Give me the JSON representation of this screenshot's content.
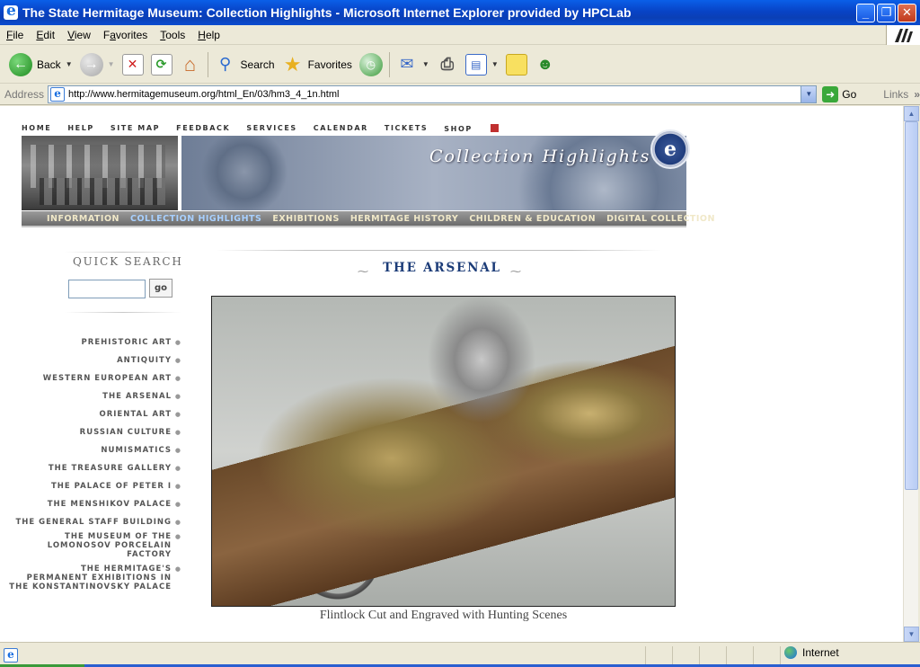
{
  "window": {
    "title": "The State Hermitage Museum: Collection Highlights - Microsoft Internet Explorer provided by HPCLab",
    "minimize": "_",
    "maximize": "❐",
    "close": "✕"
  },
  "menu": [
    {
      "u": "F",
      "rest": "ile"
    },
    {
      "u": "E",
      "rest": "dit"
    },
    {
      "u": "V",
      "rest": "iew"
    },
    {
      "u": "",
      "pre": "F",
      "mid": "a",
      "rest": "vorites"
    },
    {
      "u": "T",
      "rest": "ools"
    },
    {
      "u": "H",
      "rest": "elp"
    }
  ],
  "toolbar": {
    "back": "Back",
    "search": "Search",
    "favorites": "Favorites"
  },
  "address": {
    "label": "Address",
    "url": "http://www.hermitagemuseum.org/html_En/03/hm3_4_1n.html",
    "go": "Go",
    "links": "Links",
    "links_chevron": "»"
  },
  "site": {
    "topnav": [
      "HOME",
      "HELP",
      "SITE MAP",
      "FEEDBACK",
      "SERVICES",
      "CALENDAR",
      "TICKETS",
      "SHOP"
    ],
    "banner_title": "Collection Highlights",
    "mainnav": [
      {
        "label": "INFORMATION",
        "active": false
      },
      {
        "label": "COLLECTION HIGHLIGHTS",
        "active": true
      },
      {
        "label": "EXHIBITIONS",
        "active": false
      },
      {
        "label": "HERMITAGE HISTORY",
        "active": false
      },
      {
        "label": "CHILDREN & EDUCATION",
        "active": false
      },
      {
        "label": "DIGITAL COLLECTION",
        "active": false
      }
    ],
    "quick_search": {
      "title": "QUICK SEARCH",
      "value": "",
      "go": "go"
    },
    "sidenav": [
      "PREHISTORIC ART",
      "ANTIQUITY",
      "WESTERN EUROPEAN ART",
      "THE ARSENAL",
      "ORIENTAL ART",
      "RUSSIAN CULTURE",
      "NUMISMATICS",
      "THE TREASURE GALLERY",
      "THE PALACE OF PETER I",
      "THE MENSHIKOV PALACE",
      "THE GENERAL STAFF BUILDING",
      "THE MUSEUM OF THE\nLOMONOSOV PORCELAIN FACTORY",
      "THE HERMITAGE'S\nPERMANENT EXHIBITIONS IN\nTHE KONSTANTINOVSKY PALACE"
    ],
    "section_title": "THE ARSENAL",
    "caption": "Flintlock Cut and Engraved with Hunting Scenes"
  },
  "status": {
    "text": "",
    "zone": "Internet"
  }
}
